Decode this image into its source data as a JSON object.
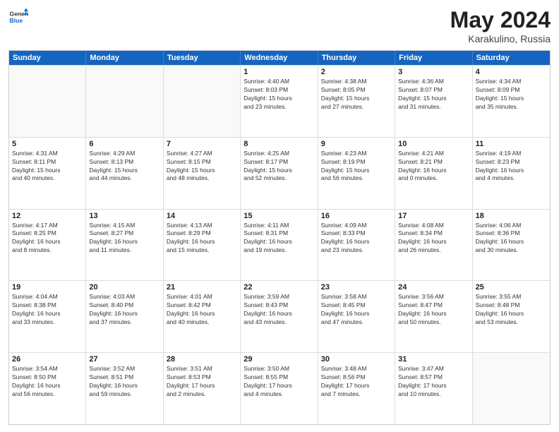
{
  "logo": {
    "general": "General",
    "blue": "Blue"
  },
  "title": {
    "month": "May 2024",
    "location": "Karakulino, Russia"
  },
  "days": [
    "Sunday",
    "Monday",
    "Tuesday",
    "Wednesday",
    "Thursday",
    "Friday",
    "Saturday"
  ],
  "weeks": [
    [
      {
        "day": "",
        "info": ""
      },
      {
        "day": "",
        "info": ""
      },
      {
        "day": "",
        "info": ""
      },
      {
        "day": "1",
        "info": "Sunrise: 4:40 AM\nSunset: 8:03 PM\nDaylight: 15 hours\nand 23 minutes."
      },
      {
        "day": "2",
        "info": "Sunrise: 4:38 AM\nSunset: 8:05 PM\nDaylight: 15 hours\nand 27 minutes."
      },
      {
        "day": "3",
        "info": "Sunrise: 4:36 AM\nSunset: 8:07 PM\nDaylight: 15 hours\nand 31 minutes."
      },
      {
        "day": "4",
        "info": "Sunrise: 4:34 AM\nSunset: 8:09 PM\nDaylight: 15 hours\nand 35 minutes."
      }
    ],
    [
      {
        "day": "5",
        "info": "Sunrise: 4:31 AM\nSunset: 8:11 PM\nDaylight: 15 hours\nand 40 minutes."
      },
      {
        "day": "6",
        "info": "Sunrise: 4:29 AM\nSunset: 8:13 PM\nDaylight: 15 hours\nand 44 minutes."
      },
      {
        "day": "7",
        "info": "Sunrise: 4:27 AM\nSunset: 8:15 PM\nDaylight: 15 hours\nand 48 minutes."
      },
      {
        "day": "8",
        "info": "Sunrise: 4:25 AM\nSunset: 8:17 PM\nDaylight: 15 hours\nand 52 minutes."
      },
      {
        "day": "9",
        "info": "Sunrise: 4:23 AM\nSunset: 8:19 PM\nDaylight: 15 hours\nand 56 minutes."
      },
      {
        "day": "10",
        "info": "Sunrise: 4:21 AM\nSunset: 8:21 PM\nDaylight: 16 hours\nand 0 minutes."
      },
      {
        "day": "11",
        "info": "Sunrise: 4:19 AM\nSunset: 8:23 PM\nDaylight: 16 hours\nand 4 minutes."
      }
    ],
    [
      {
        "day": "12",
        "info": "Sunrise: 4:17 AM\nSunset: 8:25 PM\nDaylight: 16 hours\nand 8 minutes."
      },
      {
        "day": "13",
        "info": "Sunrise: 4:15 AM\nSunset: 8:27 PM\nDaylight: 16 hours\nand 11 minutes."
      },
      {
        "day": "14",
        "info": "Sunrise: 4:13 AM\nSunset: 8:29 PM\nDaylight: 16 hours\nand 15 minutes."
      },
      {
        "day": "15",
        "info": "Sunrise: 4:11 AM\nSunset: 8:31 PM\nDaylight: 16 hours\nand 19 minutes."
      },
      {
        "day": "16",
        "info": "Sunrise: 4:09 AM\nSunset: 8:33 PM\nDaylight: 16 hours\nand 23 minutes."
      },
      {
        "day": "17",
        "info": "Sunrise: 4:08 AM\nSunset: 8:34 PM\nDaylight: 16 hours\nand 26 minutes."
      },
      {
        "day": "18",
        "info": "Sunrise: 4:06 AM\nSunset: 8:36 PM\nDaylight: 16 hours\nand 30 minutes."
      }
    ],
    [
      {
        "day": "19",
        "info": "Sunrise: 4:04 AM\nSunset: 8:38 PM\nDaylight: 16 hours\nand 33 minutes."
      },
      {
        "day": "20",
        "info": "Sunrise: 4:03 AM\nSunset: 8:40 PM\nDaylight: 16 hours\nand 37 minutes."
      },
      {
        "day": "21",
        "info": "Sunrise: 4:01 AM\nSunset: 8:42 PM\nDaylight: 16 hours\nand 40 minutes."
      },
      {
        "day": "22",
        "info": "Sunrise: 3:59 AM\nSunset: 8:43 PM\nDaylight: 16 hours\nand 43 minutes."
      },
      {
        "day": "23",
        "info": "Sunrise: 3:58 AM\nSunset: 8:45 PM\nDaylight: 16 hours\nand 47 minutes."
      },
      {
        "day": "24",
        "info": "Sunrise: 3:56 AM\nSunset: 8:47 PM\nDaylight: 16 hours\nand 50 minutes."
      },
      {
        "day": "25",
        "info": "Sunrise: 3:55 AM\nSunset: 8:48 PM\nDaylight: 16 hours\nand 53 minutes."
      }
    ],
    [
      {
        "day": "26",
        "info": "Sunrise: 3:54 AM\nSunset: 8:50 PM\nDaylight: 16 hours\nand 56 minutes."
      },
      {
        "day": "27",
        "info": "Sunrise: 3:52 AM\nSunset: 8:51 PM\nDaylight: 16 hours\nand 59 minutes."
      },
      {
        "day": "28",
        "info": "Sunrise: 3:51 AM\nSunset: 8:53 PM\nDaylight: 17 hours\nand 2 minutes."
      },
      {
        "day": "29",
        "info": "Sunrise: 3:50 AM\nSunset: 8:55 PM\nDaylight: 17 hours\nand 4 minutes."
      },
      {
        "day": "30",
        "info": "Sunrise: 3:48 AM\nSunset: 8:56 PM\nDaylight: 17 hours\nand 7 minutes."
      },
      {
        "day": "31",
        "info": "Sunrise: 3:47 AM\nSunset: 8:57 PM\nDaylight: 17 hours\nand 10 minutes."
      },
      {
        "day": "",
        "info": ""
      }
    ]
  ]
}
